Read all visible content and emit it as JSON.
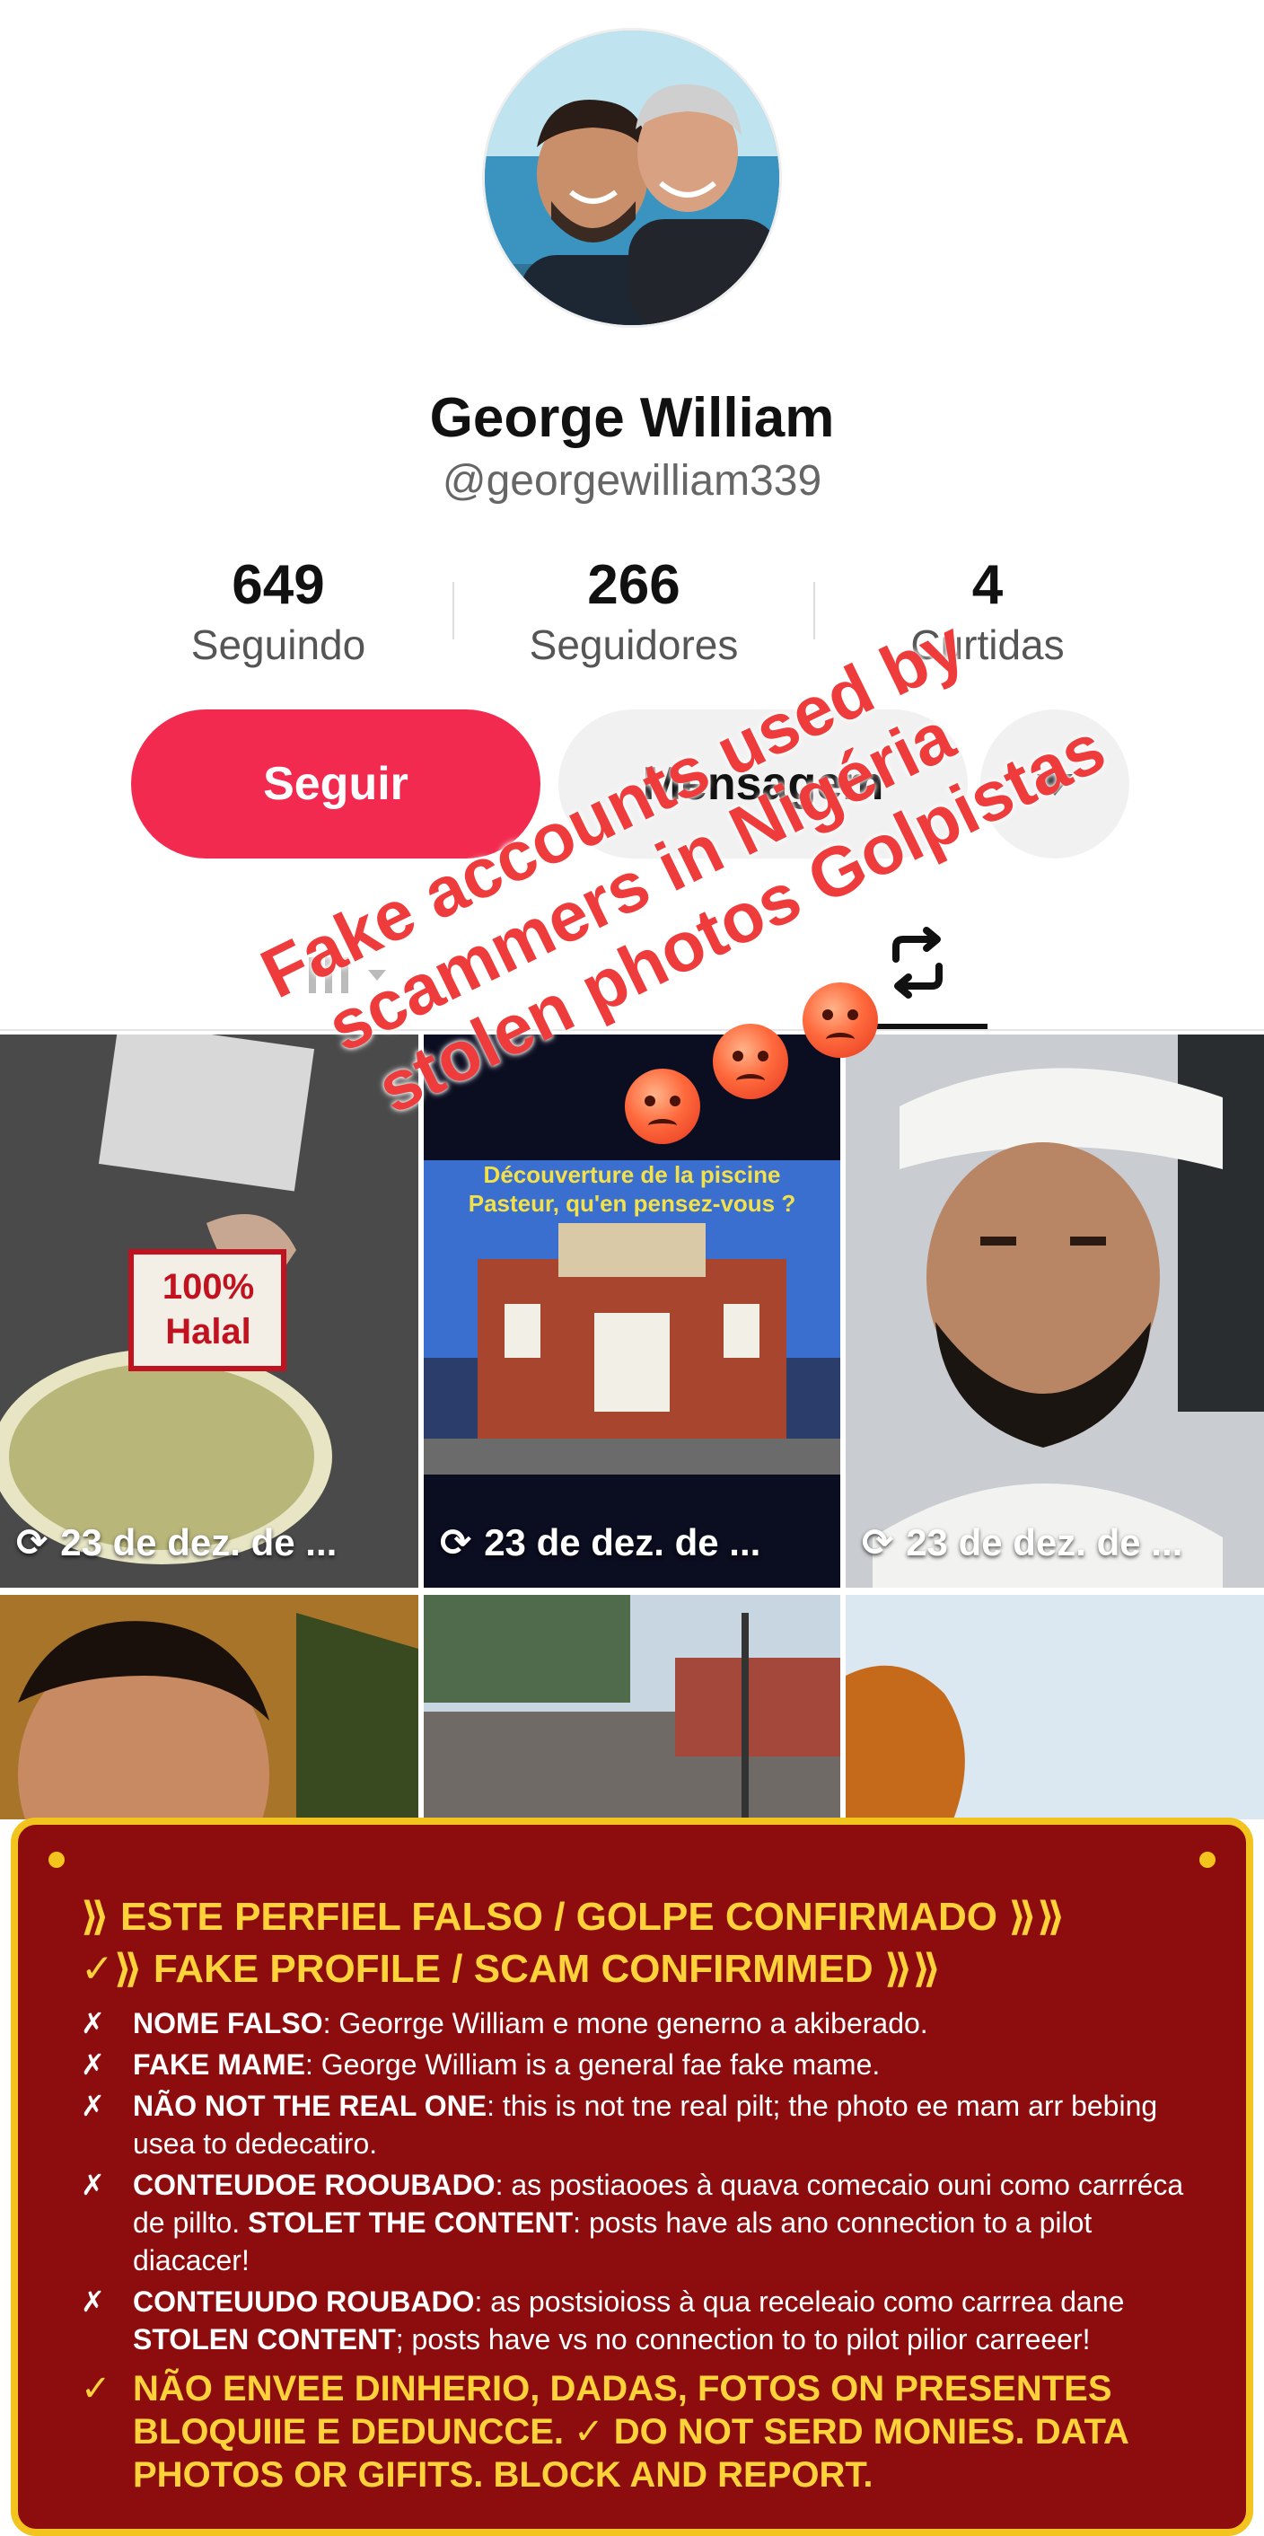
{
  "profile": {
    "name": "George William",
    "handle": "@georgewilliam339"
  },
  "stats": [
    {
      "value": "649",
      "label": "Seguindo"
    },
    {
      "value": "266",
      "label": "Seguidores"
    },
    {
      "value": "4",
      "label": "Curtidas"
    }
  ],
  "actions": {
    "follow_label": "Seguir",
    "message_label": "Mensagem"
  },
  "grid": {
    "row1": [
      {
        "badge": "100% Halal",
        "caption": "23 de dez. de ..."
      },
      {
        "poster_text": "Découverture de la piscine Pasteur, qu'en pensez-vous ?",
        "caption": "23 de dez. de ..."
      },
      {
        "caption": "23 de dez. de ..."
      }
    ]
  },
  "overlay": {
    "line1": "Fake accounts used by",
    "line2": "scammers in Nigéria",
    "line3": "stolen photos Golpistas"
  },
  "warning": {
    "title_pt": "ESTE PERFIEL FALSO / GOLPE CONFIRMADO",
    "title_en": "FAKE PROFILE / SCAM CONFIRMMED",
    "items": [
      {
        "key": "NOME FALSO",
        "text": ": Georrge William e mone generno a akiberado."
      },
      {
        "key": "FAKE MAME",
        "text": ": George William is a general fae fake mame."
      },
      {
        "key": "NÃO NOT THE REAL ONE",
        "text": ": this is not tne real pilt; the photo ee mam arr bebing usea to dedecatiro."
      },
      {
        "key": "CONTEUDOE ROOUBADO",
        "text": ": as postiaooes à quava comecaio ouni como carrréca de pillto.",
        "key2": "STOLET THE CONTENT",
        "text2": ": posts have als ano connection to a pilot diacacer!"
      },
      {
        "key": "CONTEUUDO ROUBADO",
        "text": ": as postsioioss à qua receleaio como carrrea dane",
        "key2": "STOLEN CONTENT",
        "text2": "; posts have vs no connection to to pilot pilior carreeer!"
      }
    ],
    "final": "NÃO ENVEE DINHERIO, DADAS, FOTOS ON PRESENTES BLOQUIIE E DEDUNCCE. ✓ DO NOT SERD MONIES. DATA PHOTOS OR GIFITS. BLOCK AND REPORT."
  },
  "colors": {
    "follow": "#f32a4f",
    "overlay_text": "#ee3c3c",
    "warning_bg": "#8d0d0f",
    "warning_accent": "#ffd23a"
  }
}
